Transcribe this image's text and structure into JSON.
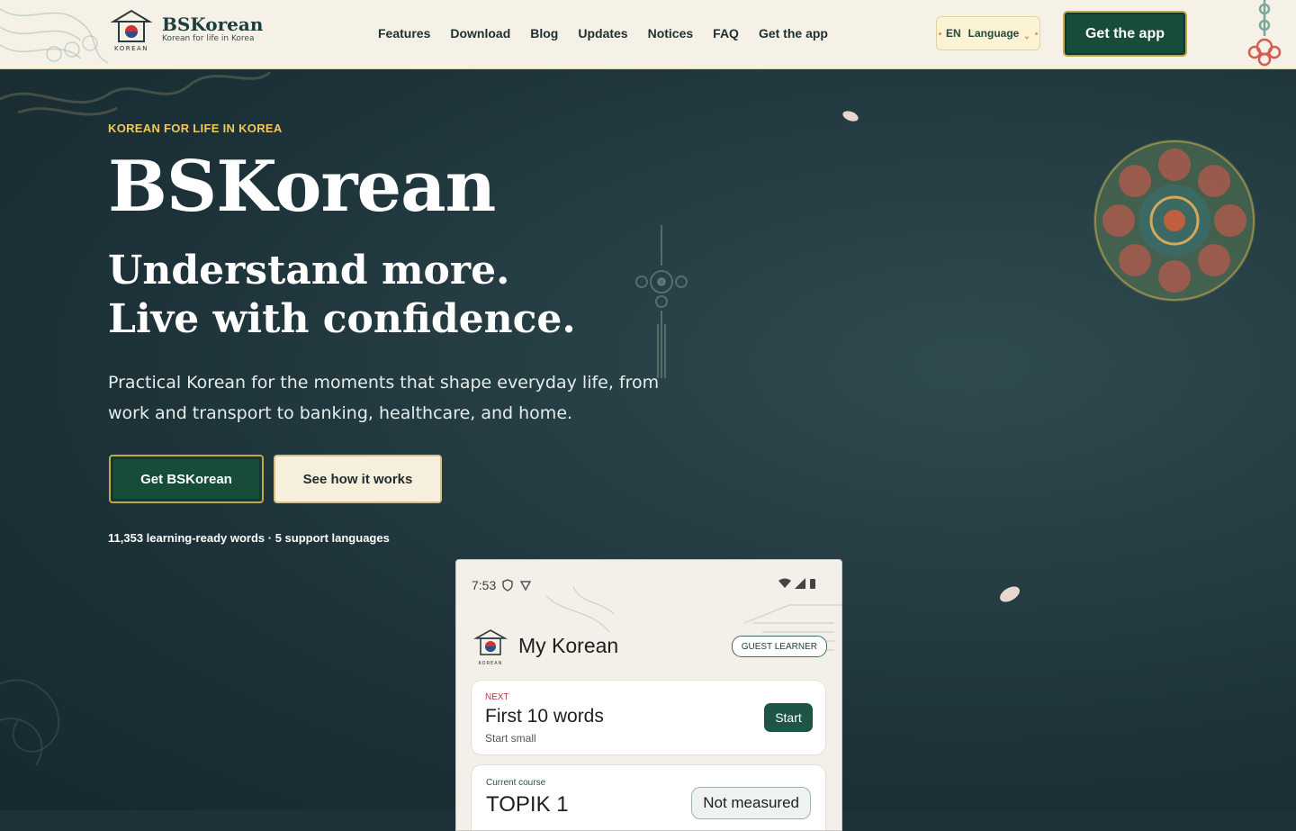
{
  "colors": {
    "brand_green": "#174c3b",
    "gold": "#c9a54a",
    "eyebrow_gold": "#f0c95a",
    "header_bg": "#f6f1e6",
    "hero_bg": "#1d3339"
  },
  "header": {
    "brand_name": "BSKorean",
    "brand_tagline": "Korean for life in Korea",
    "logo_caption": "KOREAN",
    "nav": [
      "Features",
      "Download",
      "Blog",
      "Updates",
      "Notices",
      "FAQ",
      "Get the app"
    ],
    "language": {
      "code": "EN",
      "label": "Language",
      "caret": "⌄"
    },
    "get_app_label": "Get the app"
  },
  "hero": {
    "eyebrow": "KOREAN FOR LIFE IN KOREA",
    "title": "BSKorean",
    "subtitle_line1": "Understand more.",
    "subtitle_line2": "Live with confidence.",
    "description": "Practical Korean for the moments that shape everyday life, from work and transport to banking, healthcare, and home.",
    "cta_primary": "Get BSKorean",
    "cta_secondary": "See how it works",
    "stats": "11,353 learning-ready words · 5 support languages"
  },
  "phone": {
    "time": "7:53",
    "logo_caption": "KOREAN",
    "title": "My Korean",
    "badge": "GUEST LEARNER",
    "next": {
      "label": "NEXT",
      "title": "First 10 words",
      "subtitle": "Start small",
      "button": "Start"
    },
    "course": {
      "label": "Current course",
      "title": "TOPIK 1",
      "badge": "Not measured"
    }
  }
}
